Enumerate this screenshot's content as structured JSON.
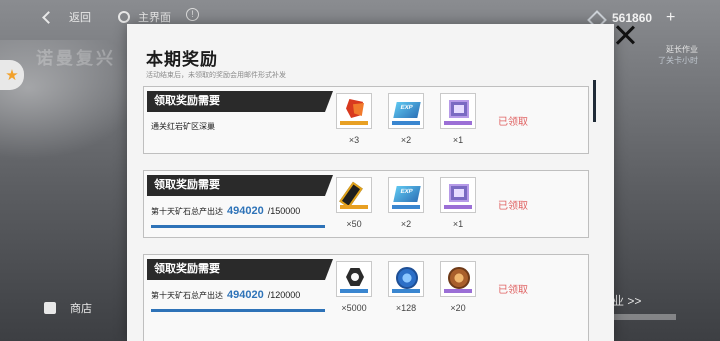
{
  "hud": {
    "back_label": "返回",
    "home_label": "主界面",
    "currency_value": "561860",
    "currency_plus": "+",
    "side_title": "诺曼复兴",
    "right_badge_top": "延长作业",
    "right_badge_sub": "了关卡小时",
    "shop_label": "商店",
    "bottom_right_label": "作业 >>"
  },
  "panel": {
    "title": "本期奖励",
    "subtitle": "活动结束后，未领取的奖励会用邮件形式补发",
    "cards": [
      {
        "header": "领取奖励需要",
        "desc": "通关红岩矿区深巢",
        "progress_value": "",
        "progress_max": "",
        "status": "已领取",
        "items": [
          {
            "icon": "red-ore-icon",
            "count": "×3"
          },
          {
            "icon": "exp-chip-icon",
            "count": "×2"
          },
          {
            "icon": "cube-module-icon",
            "count": "×1"
          }
        ]
      },
      {
        "header": "领取奖励需要",
        "desc": "第十天矿石总产出达",
        "progress_value": "494020",
        "progress_max": "/150000",
        "status": "已领取",
        "items": [
          {
            "icon": "gold-tag-icon",
            "count": "×50"
          },
          {
            "icon": "exp-chip-icon",
            "count": "×2"
          },
          {
            "icon": "cube-module-icon",
            "count": "×1"
          }
        ]
      },
      {
        "header": "领取奖励需要",
        "desc": "第十天矿石总产出达",
        "progress_value": "494020",
        "progress_max": "/120000",
        "status": "已领取",
        "items": [
          {
            "icon": "hex-nut-icon",
            "count": "×5000"
          },
          {
            "icon": "blue-coin-icon",
            "count": "×128"
          },
          {
            "icon": "brown-coin-icon",
            "count": "×20"
          }
        ]
      }
    ]
  },
  "colors": {
    "accent_blue": "#2e73b8",
    "claimed_red": "#e06262",
    "header_dark": "#2a2a2a"
  }
}
